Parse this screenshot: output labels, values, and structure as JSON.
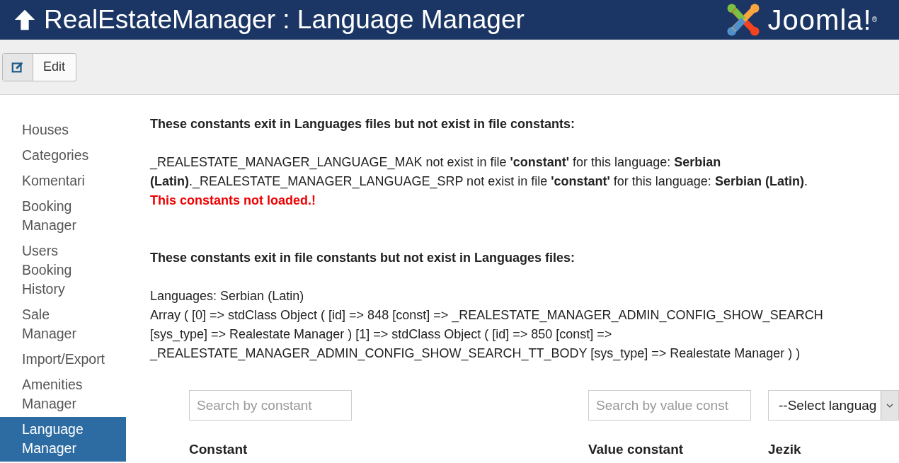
{
  "header": {
    "title": "RealEstateManager : Language Manager",
    "logo_text": "Joomla!$^{®}$"
  },
  "toolbar": {
    "buttons": [
      {
        "label": "Edit"
      }
    ]
  },
  "sidebar": {
    "items": [
      {
        "label": "Houses",
        "selected": false
      },
      {
        "label": "Categories",
        "selected": false
      },
      {
        "label": "Komentari",
        "selected": false
      },
      {
        "label": "Booking Manager",
        "selected": false
      },
      {
        "label": "Users Booking History",
        "selected": false
      },
      {
        "label": "Sale Manager",
        "selected": false
      },
      {
        "label": "Import/Export",
        "selected": false
      },
      {
        "label": "Amenities Manager",
        "selected": false
      },
      {
        "label": "Language Manager",
        "selected": true
      }
    ]
  },
  "missing_in_constants": {
    "heading": "These constants exit in Languages files but not exist in file constants:",
    "message": "_REALESTATE_MANAGER_LANGUAGE_MAK not exist in file **'constant'** for this language: **Serbian (Latin)**._REALESTATE_MANAGER_LANGUAGE_SRP not exist in file **'constant'** for this language: **Serbian (Latin)**.",
    "warning": "This constants not loaded.!"
  },
  "missing_in_languages": {
    "heading": "These constants exit in file constants but not exist in Languages files:",
    "languages_line": "Languages: Serbian (Latin)",
    "dump": "Array ( [0] => stdClass Object ( [id] => 848 [const] => _REALESTATE_MANAGER_ADMIN_CONFIG_SHOW_SEARCH [sys_type] => Realestate Manager ) [1] => stdClass Object ( [id] => 850 [const] => _REALESTATE_MANAGER_ADMIN_CONFIG_SHOW_SEARCH_TT_BODY [sys_type] => Realestate Manager ) )"
  },
  "filters": {
    "constant_search": {
      "placeholder": "Search by constant"
    },
    "value_search": {
      "placeholder": "Search by value const"
    },
    "language_select": {
      "value": "--Select languag"
    }
  },
  "table": {
    "columns": [
      "Constant",
      "Value constant",
      "Jezik"
    ]
  }
}
